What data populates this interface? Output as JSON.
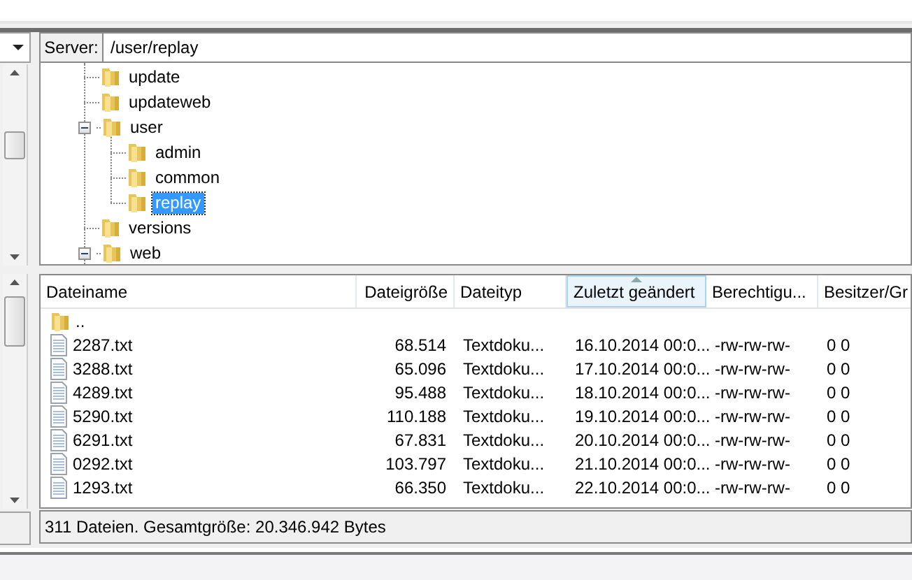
{
  "server_bar": {
    "label": "Server:",
    "value": "/user/replay"
  },
  "tree": [
    {
      "name": "update",
      "selected": false
    },
    {
      "name": "updateweb",
      "selected": false
    },
    {
      "name": "user",
      "expanded": true,
      "selected": false,
      "children": [
        {
          "name": "admin",
          "selected": false
        },
        {
          "name": "common",
          "selected": false
        },
        {
          "name": "replay",
          "selected": true
        }
      ]
    },
    {
      "name": "versions",
      "selected": false
    },
    {
      "name": "web",
      "expanded": true,
      "selected": false
    }
  ],
  "columns": [
    {
      "label": "Dateiname",
      "sorted": false
    },
    {
      "label": "Dateigröße",
      "sorted": false
    },
    {
      "label": "Dateityp",
      "sorted": false
    },
    {
      "label": "Zuletzt geändert",
      "sorted": true
    },
    {
      "label": "Berechtigu...",
      "sorted": false
    },
    {
      "label": "Besitzer/Gr",
      "sorted": false
    }
  ],
  "rows": [
    {
      "kind": "parent",
      "cells": [
        ".."
      ]
    },
    {
      "kind": "file",
      "cells": [
        "2287.txt",
        "68.514",
        "Textdoku...",
        "16.10.2014 00:0...",
        "-rw-rw-rw-",
        "0 0"
      ]
    },
    {
      "kind": "file",
      "cells": [
        "3288.txt",
        "65.096",
        "Textdoku...",
        "17.10.2014 00:0...",
        "-rw-rw-rw-",
        "0 0"
      ]
    },
    {
      "kind": "file",
      "cells": [
        "4289.txt",
        "95.488",
        "Textdoku...",
        "18.10.2014 00:0...",
        "-rw-rw-rw-",
        "0 0"
      ]
    },
    {
      "kind": "file",
      "cells": [
        "5290.txt",
        "110.188",
        "Textdoku...",
        "19.10.2014 00:0...",
        "-rw-rw-rw-",
        "0 0"
      ]
    },
    {
      "kind": "file",
      "cells": [
        "6291.txt",
        "67.831",
        "Textdoku...",
        "20.10.2014 00:0...",
        "-rw-rw-rw-",
        "0 0"
      ]
    },
    {
      "kind": "file",
      "cells": [
        "0292.txt",
        "103.797",
        "Textdoku...",
        "21.10.2014 00:0...",
        "-rw-rw-rw-",
        "0 0"
      ]
    },
    {
      "kind": "file",
      "cells": [
        "1293.txt",
        "66.350",
        "Textdoku...",
        "22.10.2014 00:0...",
        "-rw-rw-rw-",
        "0 0"
      ]
    }
  ],
  "status_bar": "311 Dateien. Gesamtgröße: 20.346.942 Bytes"
}
